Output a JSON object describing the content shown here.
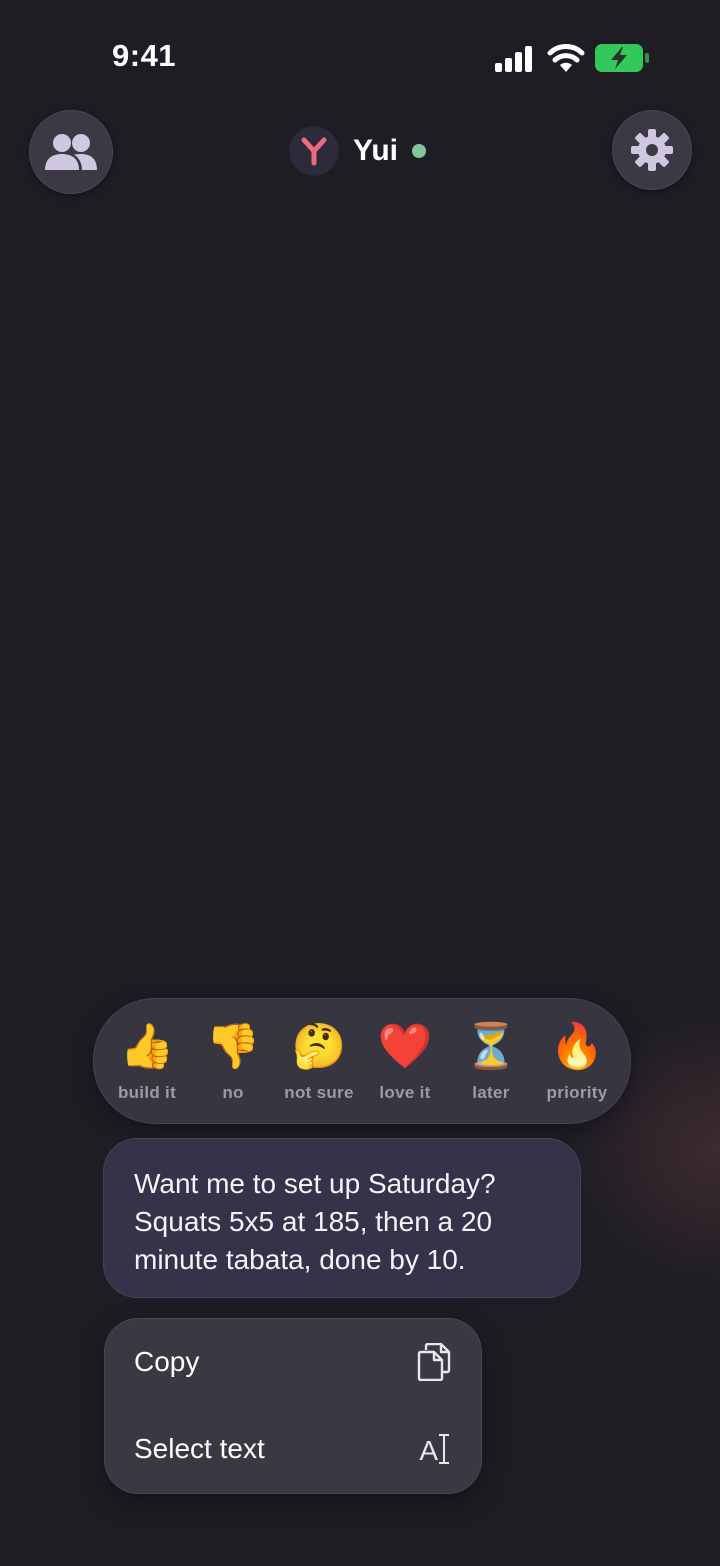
{
  "status_bar": {
    "time": "9:41"
  },
  "header": {
    "agent_name": "Yui",
    "avatar_letter": "Y",
    "status": "online",
    "accent_color": "#f06b7a",
    "online_color": "#7fc79b",
    "left_button_icon": "people-icon",
    "right_button_icon": "gear-icon"
  },
  "reactions": [
    {
      "emoji": "👍",
      "label": "build it",
      "icon": "thumbs-up-icon"
    },
    {
      "emoji": "👎",
      "label": "no",
      "icon": "thumbs-down-icon"
    },
    {
      "emoji": "🤔",
      "label": "not sure",
      "icon": "thinking-face-icon"
    },
    {
      "emoji": "❤️",
      "label": "love it",
      "icon": "heart-icon"
    },
    {
      "emoji": "⏳",
      "label": "later",
      "icon": "hourglass-icon"
    },
    {
      "emoji": "🔥",
      "label": "priority",
      "icon": "fire-icon"
    }
  ],
  "message": {
    "text": "Want me to set up Saturday?\nSquats 5x5 at 185, then a 20\nminute tabata, done by 10."
  },
  "context_menu": {
    "items": [
      {
        "label": "Copy",
        "icon": "copy-icon"
      },
      {
        "label": "Select text",
        "icon": "select-text-icon",
        "icon_glyph": "A"
      }
    ]
  }
}
